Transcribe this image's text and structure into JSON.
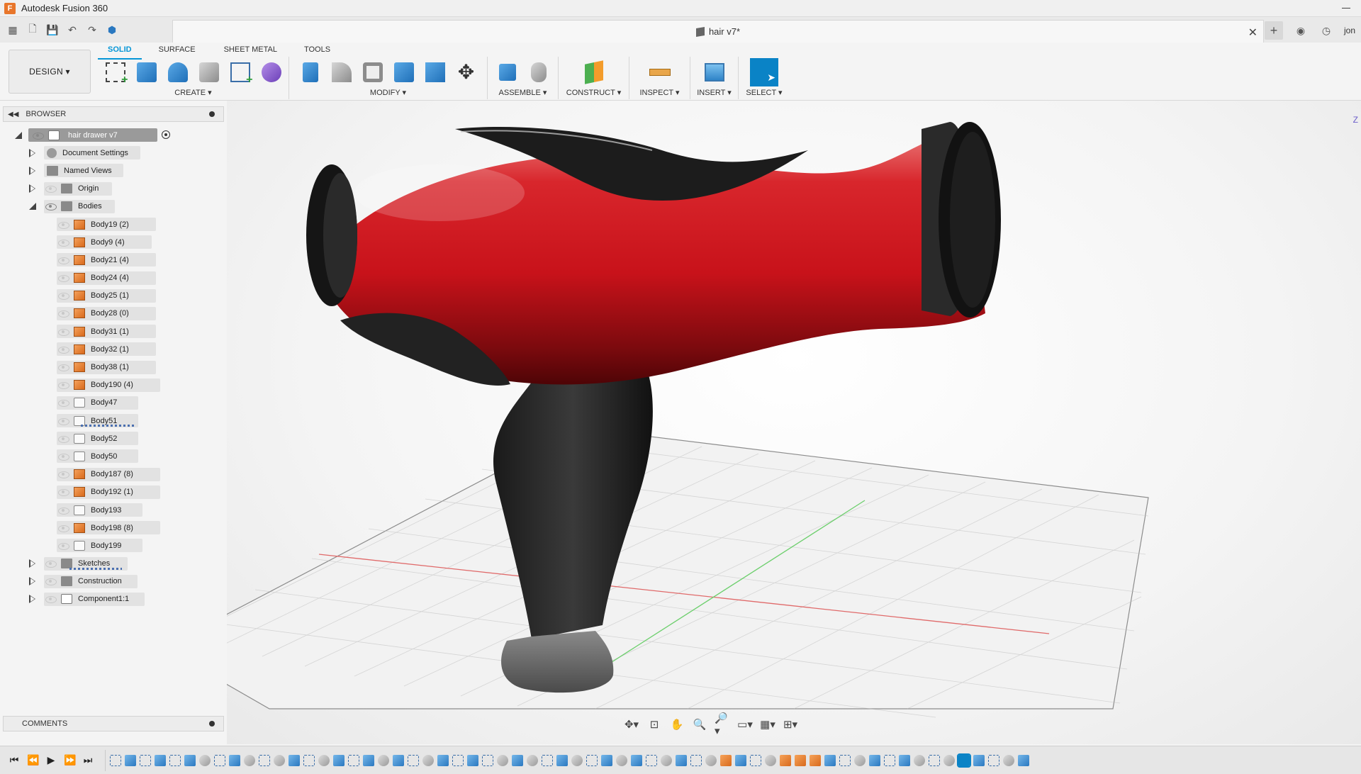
{
  "app": {
    "title": "Autodesk Fusion 360",
    "logo_letter": "F"
  },
  "document": {
    "tab_title": "hair v7*"
  },
  "user": {
    "abbr": "jon"
  },
  "workspace": {
    "label": "DESIGN ▾"
  },
  "ribbon": {
    "tabs": [
      "SOLID",
      "SURFACE",
      "SHEET METAL",
      "TOOLS"
    ],
    "active_tab": "SOLID",
    "groups": {
      "create": "CREATE ▾",
      "modify": "MODIFY ▾",
      "assemble": "ASSEMBLE ▾",
      "construct": "CONSTRUCT ▾",
      "inspect": "INSPECT ▾",
      "insert": "INSERT ▾",
      "select": "SELECT ▾"
    }
  },
  "browser": {
    "header": "BROWSER",
    "root": "hair drawer v7",
    "nodes": {
      "document_settings": "Document Settings",
      "named_views": "Named Views",
      "origin": "Origin",
      "bodies": "Bodies",
      "sketches": "Sketches",
      "construction": "Construction",
      "component": "Component1:1"
    },
    "bodies": [
      {
        "label": "Body19 (2)",
        "type": "solid"
      },
      {
        "label": "Body9 (4)",
        "type": "solid"
      },
      {
        "label": "Body21 (4)",
        "type": "solid"
      },
      {
        "label": "Body24 (4)",
        "type": "solid"
      },
      {
        "label": "Body25 (1)",
        "type": "solid"
      },
      {
        "label": "Body28 (0)",
        "type": "solid"
      },
      {
        "label": "Body31 (1)",
        "type": "solid"
      },
      {
        "label": "Body32 (1)",
        "type": "solid"
      },
      {
        "label": "Body38 (1)",
        "type": "solid"
      },
      {
        "label": "Body190 (4)",
        "type": "solid"
      },
      {
        "label": "Body47",
        "type": "surface"
      },
      {
        "label": "Body51",
        "type": "surface"
      },
      {
        "label": "Body52",
        "type": "surface"
      },
      {
        "label": "Body50",
        "type": "surface"
      },
      {
        "label": "Body187 (8)",
        "type": "solid"
      },
      {
        "label": "Body192 (1)",
        "type": "solid"
      },
      {
        "label": "Body193",
        "type": "surface"
      },
      {
        "label": "Body198 (8)",
        "type": "solid"
      },
      {
        "label": "Body199",
        "type": "surface"
      }
    ]
  },
  "comments": {
    "header": "COMMENTS"
  },
  "viewcube": {
    "axis_label": "Z"
  },
  "colors": {
    "accent": "#0696d7",
    "select_active": "#0a83c6",
    "body_red": "#c8121a"
  }
}
